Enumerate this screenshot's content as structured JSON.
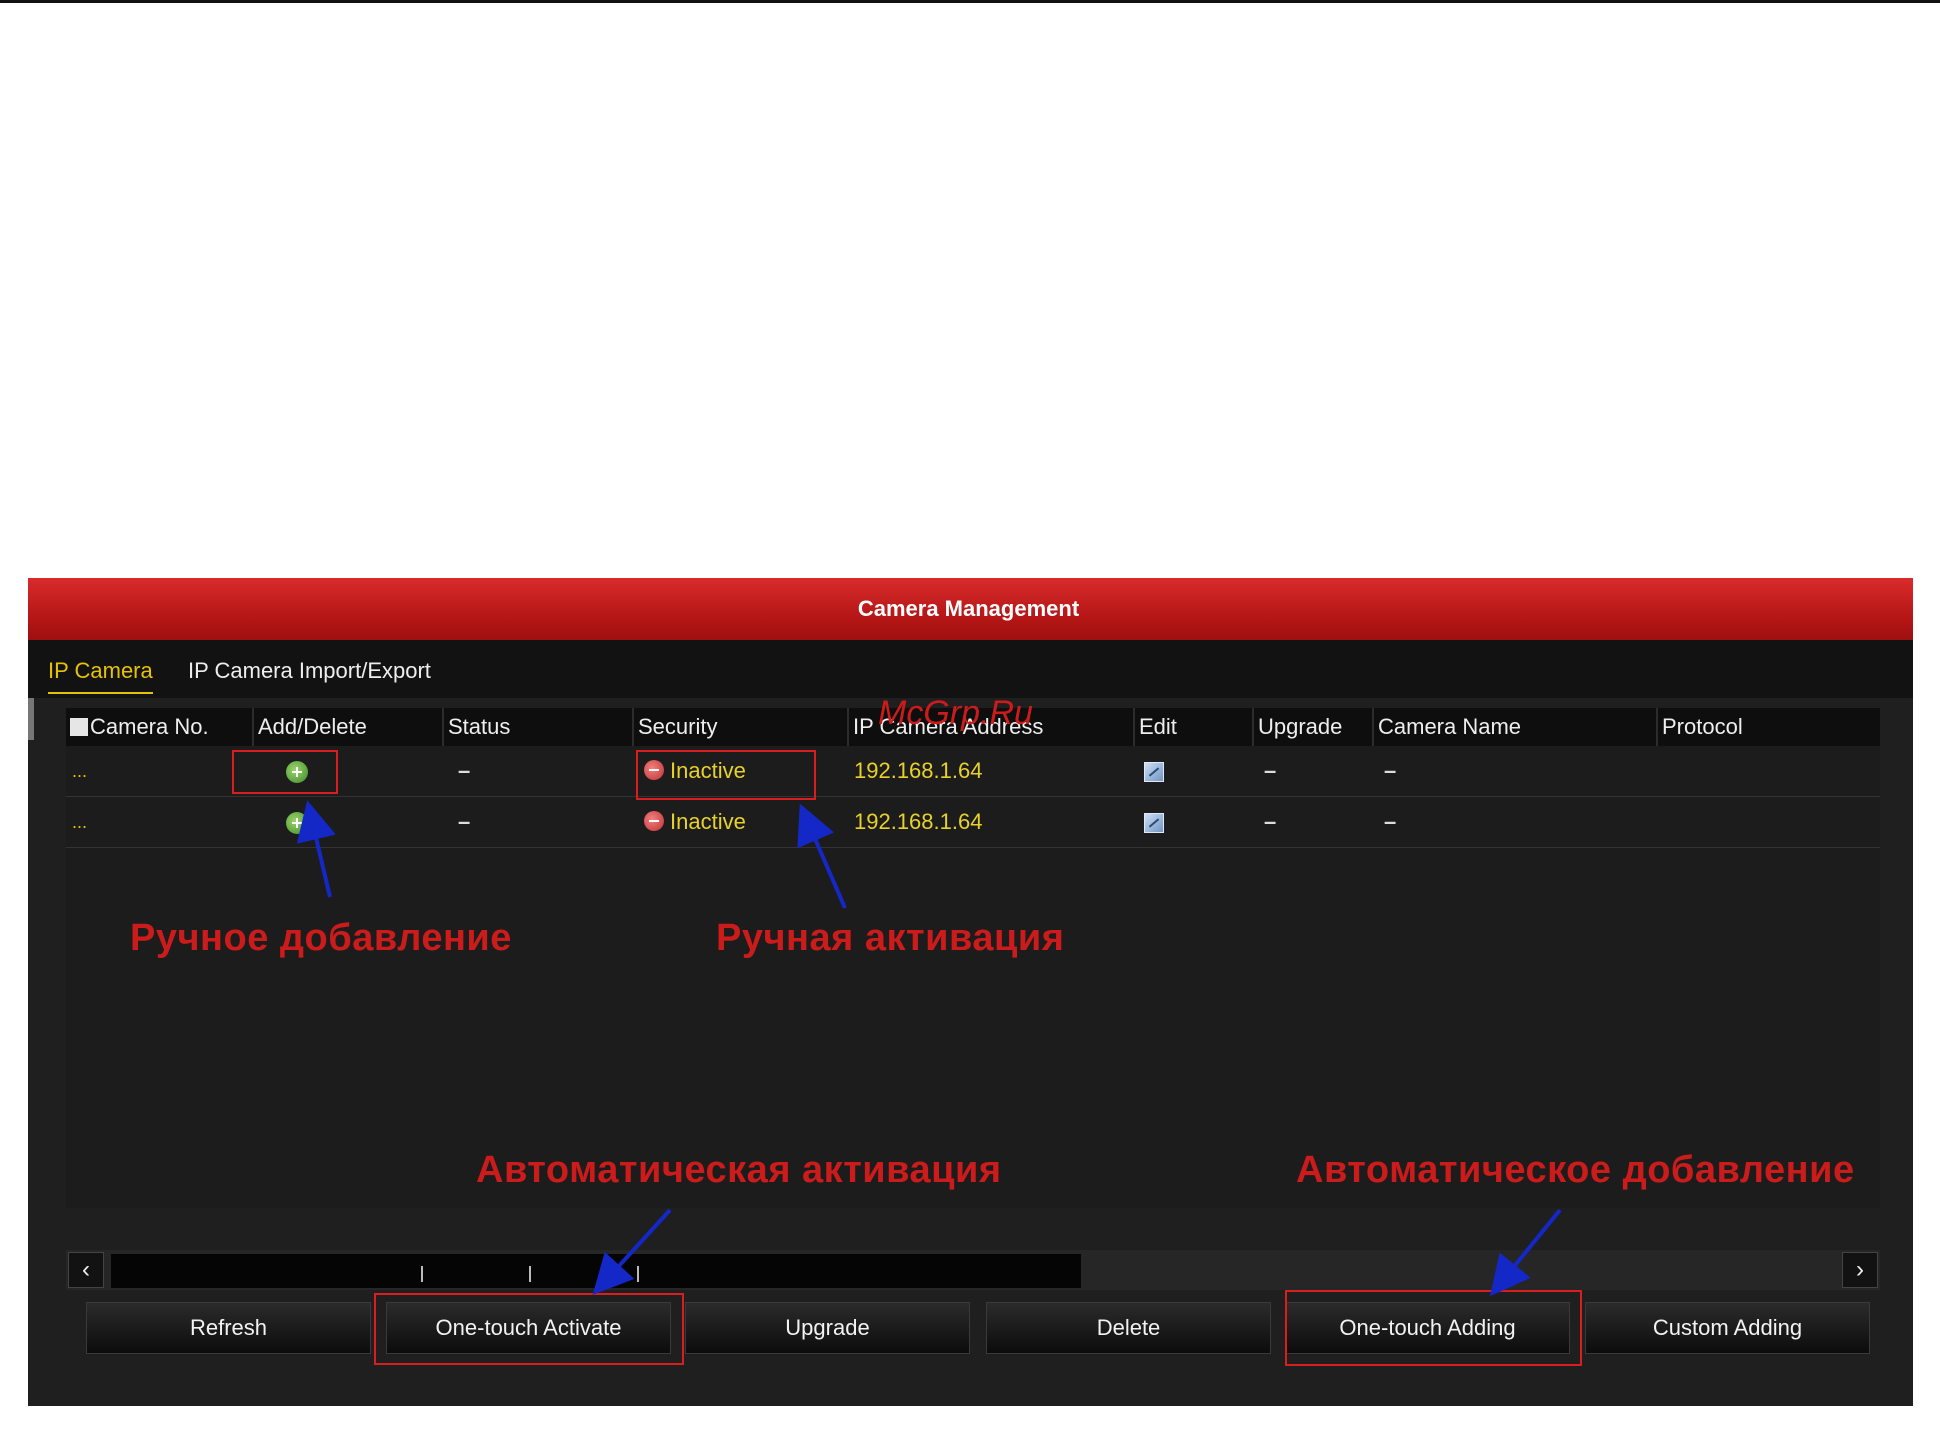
{
  "window": {
    "title": "Camera Management"
  },
  "tabs": [
    {
      "label": "IP Camera",
      "active": true
    },
    {
      "label": "IP Camera Import/Export",
      "active": false
    }
  ],
  "table": {
    "columns": [
      "Camera No.",
      "Add/Delete",
      "Status",
      "Security",
      "IP Camera Address",
      "Edit",
      "Upgrade",
      "Camera Name",
      "Protocol"
    ],
    "rows": [
      {
        "camera_no": "...",
        "status": "–",
        "security": "Inactive",
        "ip": "192.168.1.64",
        "upgrade": "–",
        "camera_name": "–"
      },
      {
        "camera_no": "...",
        "status": "–",
        "security": "Inactive",
        "ip": "192.168.1.64",
        "upgrade": "–",
        "camera_name": "–"
      }
    ]
  },
  "scrollbar": {
    "left_icon": "chevron-left-icon",
    "right_icon": "chevron-right-icon"
  },
  "buttons": {
    "refresh": "Refresh",
    "one_touch_activate": "One-touch Activate",
    "upgrade": "Upgrade",
    "delete": "Delete",
    "one_touch_adding": "One-touch Adding",
    "custom_adding": "Custom Adding"
  },
  "annotations": {
    "manual_add": "Ручное добавление",
    "manual_activate": "Ручная активация",
    "auto_activate": "Автоматическая активация",
    "auto_add": "Автоматическое добавление",
    "watermark": "McGrp.Ru"
  },
  "colors": {
    "title_red": "#c41e1e",
    "accent_yellow": "#e6c200",
    "annotation_red": "#cc1b1b",
    "arrow_blue": "#1428c8"
  }
}
